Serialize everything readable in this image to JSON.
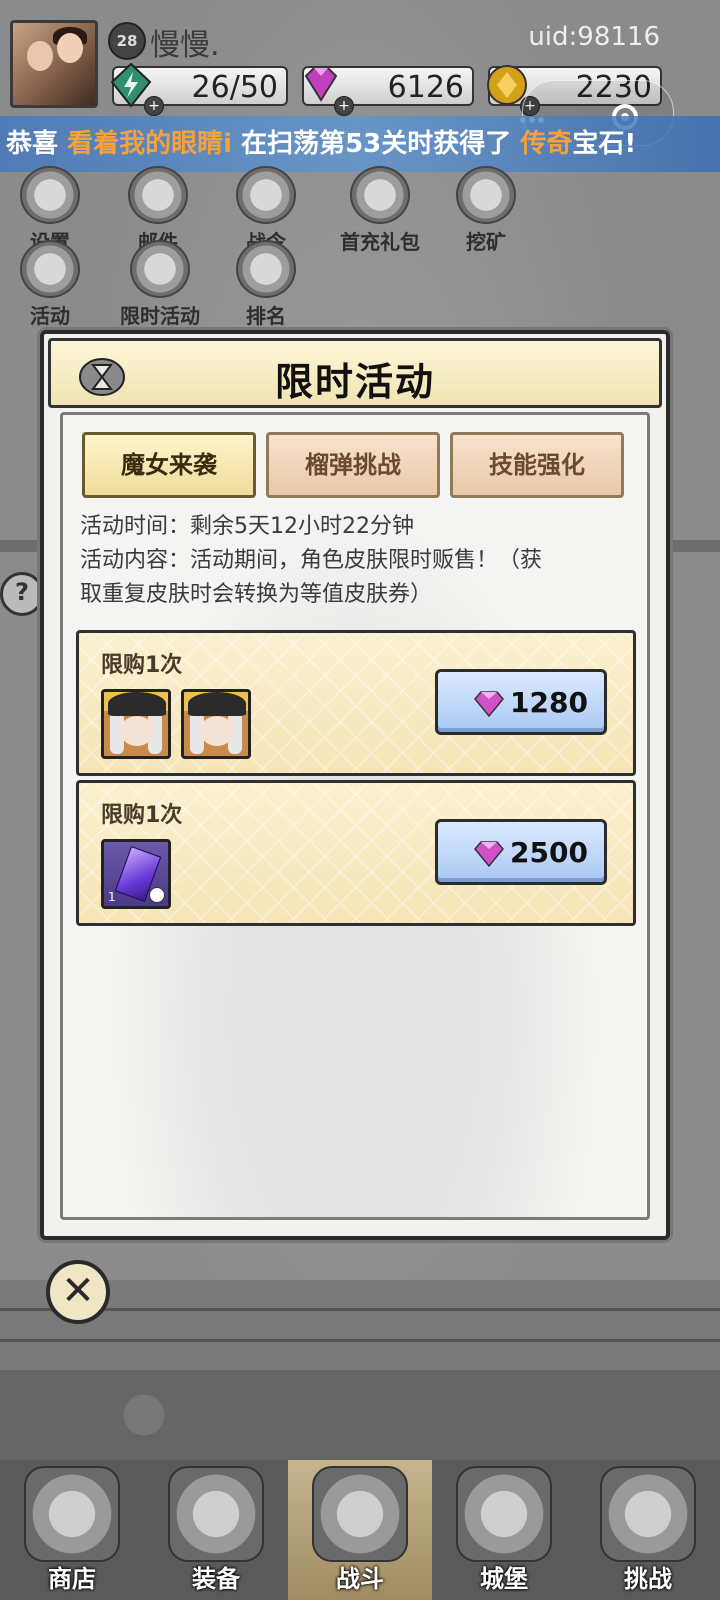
{
  "header": {
    "level": "28",
    "username": "慢慢.",
    "uid": "uid:98116",
    "resources": [
      {
        "name": "energy",
        "value": "26/50",
        "icon": "green-lightning-icon",
        "color": "#2f8f6f"
      },
      {
        "name": "gems",
        "value": "6126",
        "icon": "purple-gem-icon",
        "color": "#c040c0"
      },
      {
        "name": "gold",
        "value": "2230",
        "icon": "gold-coin-icon",
        "color": "#d4a017"
      }
    ],
    "plus": "+"
  },
  "marquee": {
    "prefix": "恭喜",
    "player": "看着我的眼睛i",
    "middle": "在扫荡第53关时获得了",
    "item": "传奇",
    "suffix": "宝石!"
  },
  "menu": [
    {
      "label": "设置",
      "icon": "gear-icon"
    },
    {
      "label": "邮件",
      "icon": "mail-icon"
    },
    {
      "label": "战令",
      "icon": "battle-pass-icon"
    },
    {
      "label": "首充礼包",
      "icon": "gift-icon"
    },
    {
      "label": "挖矿",
      "icon": "mining-icon"
    },
    {
      "label": "活动",
      "icon": "laurel-icon"
    },
    {
      "label": "限时活动",
      "icon": "hourglass-icon"
    },
    {
      "label": "排名",
      "icon": "ranking-icon"
    }
  ],
  "help": "?",
  "modal": {
    "title": "限时活动",
    "tabs": [
      {
        "label": "魔女来袭",
        "active": true
      },
      {
        "label": "榴弹挑战",
        "active": false
      },
      {
        "label": "技能强化",
        "active": false
      }
    ],
    "time_line": "活动时间：剩余5天12小时22分钟",
    "content_line1": "活动内容：活动期间，角色皮肤限时贩售！（获",
    "content_line2": "取重复皮肤时会转换为等值皮肤券）",
    "offers": [
      {
        "limit": "限购1次",
        "items": [
          "witch-skin-icon",
          "witch-skin-icon"
        ],
        "price": "1280"
      },
      {
        "limit": "限购1次",
        "items": [
          "purple-crystal-icon"
        ],
        "item_count": "1",
        "price": "2500"
      }
    ],
    "close": "✕"
  },
  "bottom_nav": [
    {
      "label": "商店",
      "icon": "shop-icon",
      "active": false
    },
    {
      "label": "装备",
      "icon": "backpack-icon",
      "active": false
    },
    {
      "label": "战斗",
      "icon": "crossed-swords-icon",
      "active": true
    },
    {
      "label": "城堡",
      "icon": "castle-icon",
      "active": false
    },
    {
      "label": "挑战",
      "icon": "shield-icon",
      "active": false
    }
  ]
}
